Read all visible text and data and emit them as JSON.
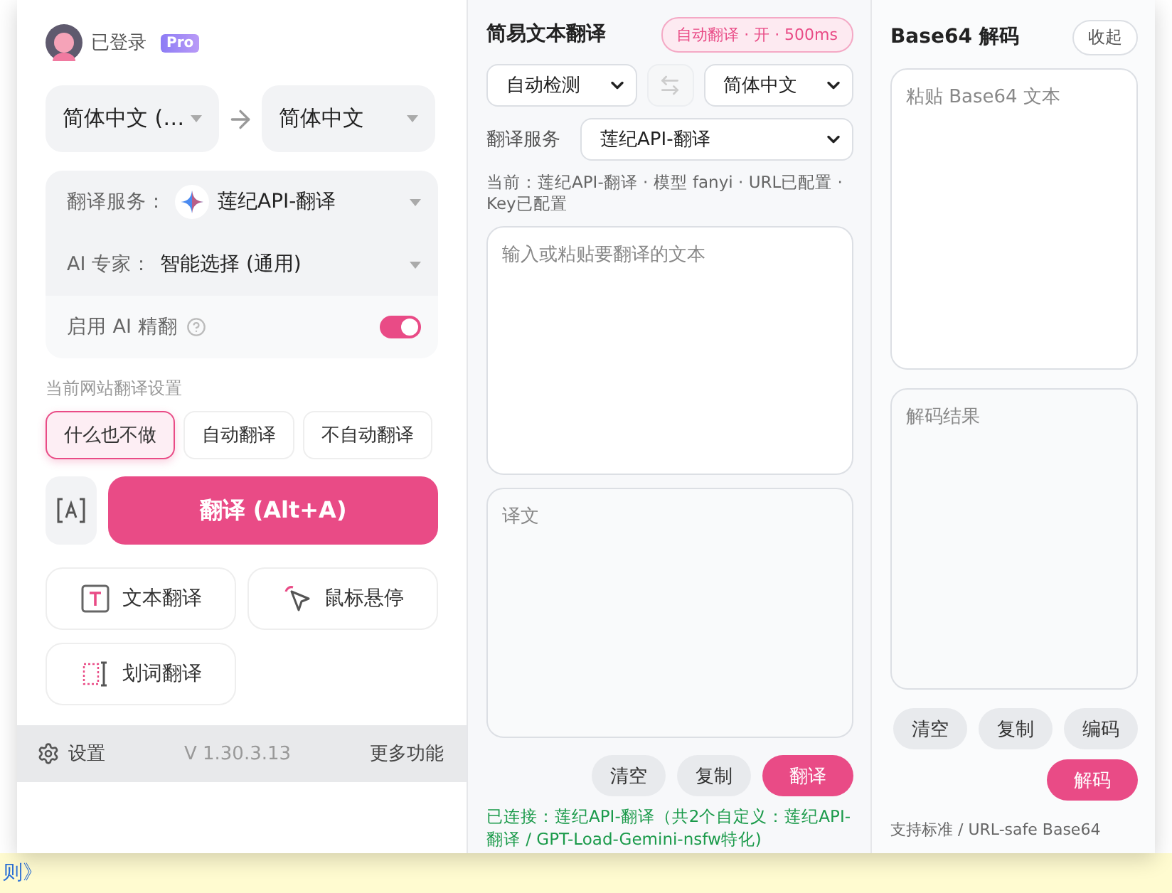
{
  "account": {
    "status": "已登录",
    "badge": "Pro"
  },
  "languages": {
    "source": "简体中文 (…",
    "target": "简体中文"
  },
  "service": {
    "label": "翻译服务：",
    "value": "莲纪API-翻译"
  },
  "expert": {
    "label": "AI 专家：",
    "value": "智能选择 (通用)"
  },
  "refine": {
    "label": "启用 AI 精翻",
    "on": true
  },
  "site_settings": {
    "title": "当前网站翻译设置",
    "options": [
      {
        "label": "什么也不做",
        "selected": true
      },
      {
        "label": "自动翻译",
        "selected": false
      },
      {
        "label": "不自动翻译",
        "selected": false
      }
    ]
  },
  "translate_button": "翻译 (Alt+A)",
  "tools": [
    {
      "label": "文本翻译",
      "kind": "text"
    },
    {
      "label": "鼠标悬停",
      "kind": "hover"
    },
    {
      "label": "划词翻译",
      "kind": "select"
    }
  ],
  "footer": {
    "settings": "设置",
    "version": "V 1.30.3.13",
    "more": "更多功能"
  },
  "simple_translate": {
    "title": "简易文本翻译",
    "badge": "自动翻译 · 开 · 500ms",
    "source": "自动检测",
    "target": "简体中文",
    "service_label": "翻译服务",
    "service": "莲纪API-翻译",
    "info": "当前：莲纪API-翻译 · 模型 fanyi · URL已配置 · Key已配置",
    "input_placeholder": "输入或粘贴要翻译的文本",
    "output_placeholder": "译文",
    "buttons": [
      {
        "label": "清空",
        "kind": "secondary"
      },
      {
        "label": "复制",
        "kind": "secondary"
      },
      {
        "label": "翻译",
        "kind": "primary"
      }
    ],
    "status": "已连接：莲纪API-翻译（共2个自定义：莲纪API-翻译 / GPT-Load-Gemini-nsfw特化)"
  },
  "base64": {
    "title": "Base64 解码",
    "collapse": "收起",
    "input_placeholder": "粘贴 Base64 文本",
    "output_placeholder": "解码结果",
    "buttons": [
      {
        "label": "清空",
        "kind": "secondary"
      },
      {
        "label": "复制",
        "kind": "secondary"
      },
      {
        "label": "编码",
        "kind": "secondary"
      },
      {
        "label": "解码",
        "kind": "primary"
      }
    ],
    "note": "支持标准 / URL-safe Base64"
  },
  "background": {
    "text": "则》"
  }
}
